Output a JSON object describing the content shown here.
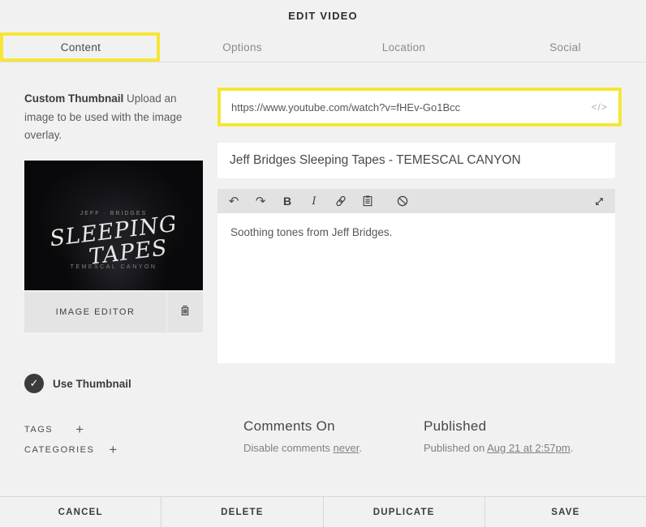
{
  "header": {
    "title": "EDIT VIDEO"
  },
  "tabs": [
    {
      "label": "Content",
      "active": true
    },
    {
      "label": "Options",
      "active": false
    },
    {
      "label": "Location",
      "active": false
    },
    {
      "label": "Social",
      "active": false
    }
  ],
  "left_panel": {
    "desc_bold": "Custom Thumbnail",
    "desc_rest": " Upload an image to be used with the image overlay.",
    "artwork": {
      "artist": "JEFF · BRIDGES",
      "title_line1": "SLEEPING",
      "title_line2": "TAPES",
      "subtitle": "TEMESCAL CANYON"
    },
    "image_editor_label": "IMAGE EDITOR",
    "trash_icon": "trash-icon",
    "use_thumbnail": {
      "checked": true,
      "check_glyph": "✓",
      "label": "Use Thumbnail"
    },
    "tags_label": "TAGS",
    "categories_label": "CATEGORIES",
    "add_symbol": "+"
  },
  "url_field": {
    "value": "https://www.youtube.com/watch?v=fHEv-Go1Bcc",
    "code_icon_glyph": "</>"
  },
  "title_field": {
    "value": "Jeff Bridges Sleeping Tapes - TEMESCAL CANYON"
  },
  "editor": {
    "toolbar_icons": [
      "undo-icon",
      "redo-icon",
      "bold-icon",
      "italic-icon",
      "link-icon",
      "paste-icon",
      "clear-format-icon",
      "expand-icon"
    ],
    "undo_glyph": "↶",
    "redo_glyph": "↷",
    "bold_glyph": "B",
    "italic_glyph": "I",
    "body_text": "Soothing tones from Jeff Bridges."
  },
  "comments": {
    "heading": "Comments On",
    "prefix": "Disable comments ",
    "link": "never",
    "suffix": "."
  },
  "published": {
    "heading": "Published",
    "prefix": "Published on ",
    "link": "Aug 21 at 2:57pm",
    "suffix": "."
  },
  "footer": {
    "buttons": [
      "CANCEL",
      "DELETE",
      "DUPLICATE",
      "SAVE"
    ]
  },
  "colors": {
    "highlight_yellow": "#f5e636",
    "page_bg": "#f1f1f1",
    "field_bg": "#ffffff",
    "toolbar_bg": "#e2e2e2",
    "checkbox_dark": "#3b3b3b"
  }
}
